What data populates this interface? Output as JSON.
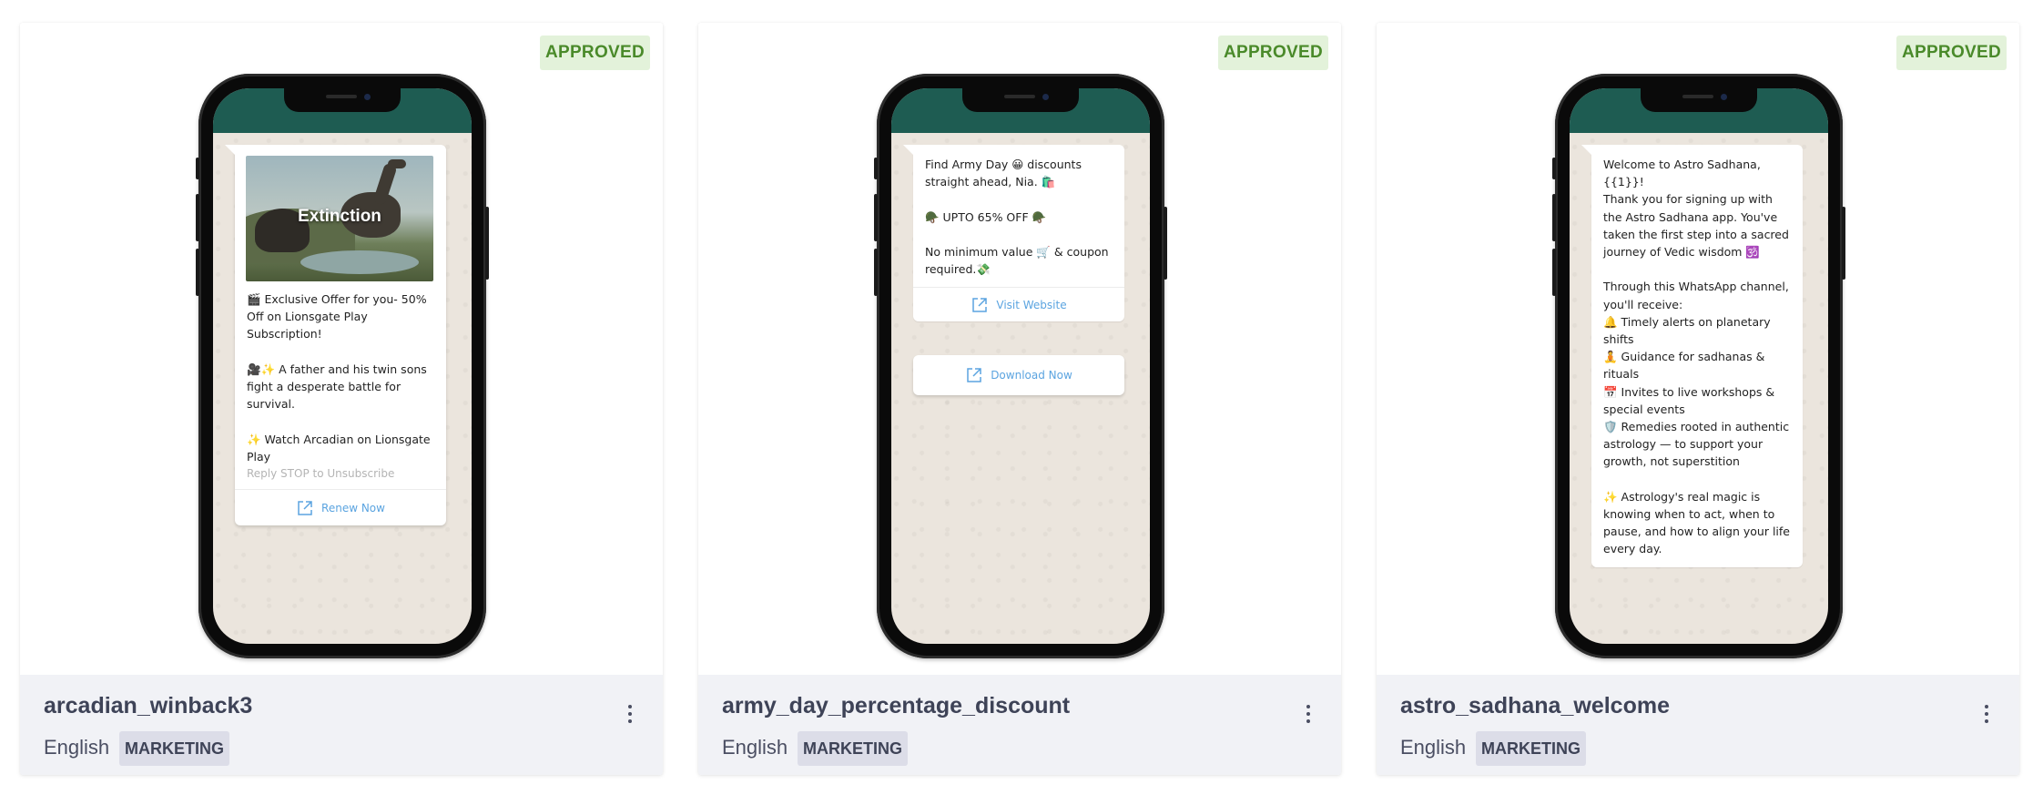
{
  "cards": [
    {
      "status": "APPROVED",
      "name": "arcadian_winback3",
      "language": "English",
      "category": "MARKETING",
      "media_title": "Extinction",
      "body": "🎬 Exclusive Offer for you- 50% Off on Lionsgate Play Subscription!\n\n🎥✨ A father and his twin sons fight a desperate battle for survival.\n\n✨ Watch Arcadian on Lionsgate Play",
      "footer": "Reply STOP to Unsubscribe",
      "buttons": [
        "Renew Now"
      ]
    },
    {
      "status": "APPROVED",
      "name": "army_day_percentage_discount",
      "language": "English",
      "category": "MARKETING",
      "body": "Find Army Day 😀 discounts straight ahead, Nia. 🛍️\n\n🪖 UPTO 65% OFF 🪖\n\nNo minimum value 🛒 & coupon required.💸",
      "buttons": [
        "Visit Website",
        "Download Now"
      ]
    },
    {
      "status": "APPROVED",
      "name": "astro_sadhana_welcome",
      "language": "English",
      "category": "MARKETING",
      "body": "Welcome to Astro Sadhana, {{1}}!\nThank you for signing up with the Astro Sadhana app. You've taken the first step into a sacred journey of Vedic wisdom 🕉️\n\nThrough this WhatsApp channel, you'll receive:\n🔔 Timely alerts on planetary shifts\n🧘 Guidance for sadhanas & rituals\n📅 Invites to live workshops & special events\n🛡️ Remedies rooted in authentic astrology — to support your growth, not superstition\n\n✨ Astrology's real magic is knowing when to act, when to pause, and how to align your life every day."
    }
  ],
  "colors": {
    "approved_bg": "#e3f2da",
    "approved_text": "#4a8a2a",
    "whatsapp_header": "#1e5c52",
    "link": "#5ba4e0",
    "footer_bg": "#f1f2f6"
  },
  "icons": {
    "button_icon": "external-link-icon",
    "menu_icon": "kebab-menu-icon"
  }
}
